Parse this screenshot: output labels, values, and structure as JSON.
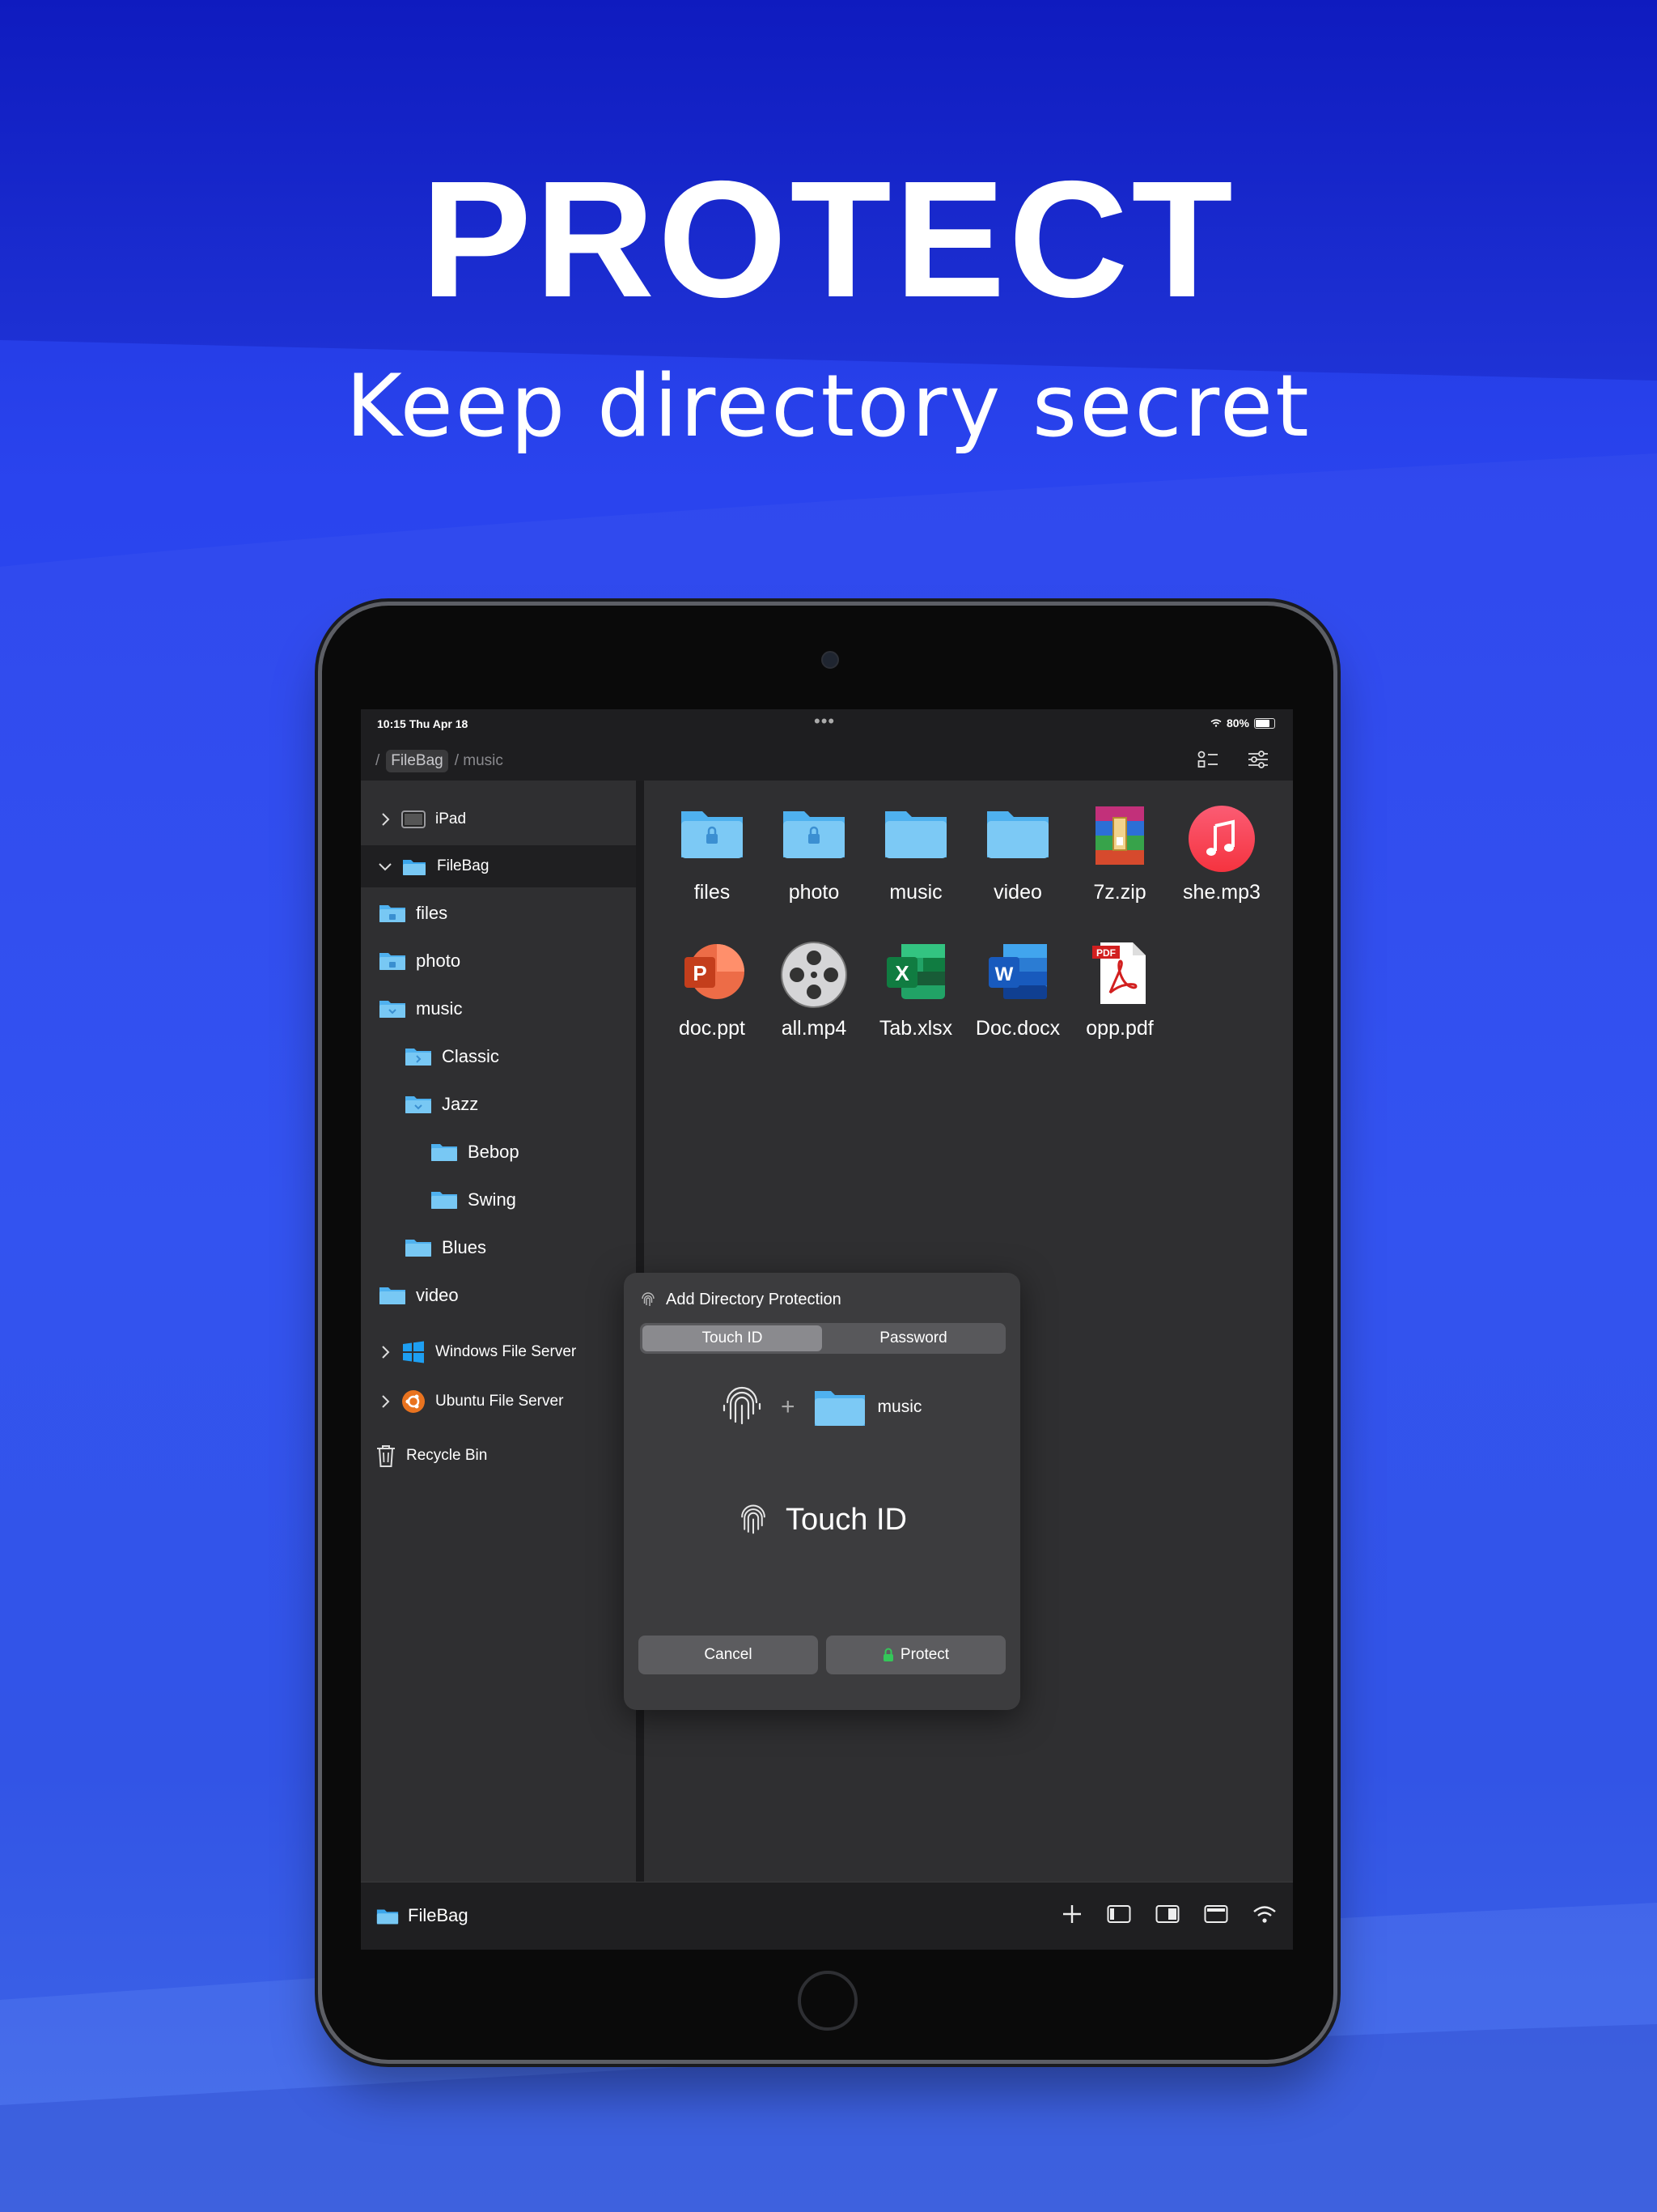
{
  "hero": {
    "title": "PROTECT",
    "subtitle": "Keep directory secret"
  },
  "status": {
    "time": "10:15  Thu Apr 18",
    "battery": "80%",
    "battery_level": 0.8
  },
  "nav": {
    "root_sep": "/",
    "crumb_active": "FileBag",
    "crumb_current": "/ music"
  },
  "sidebar": {
    "items": [
      {
        "label": "iPad",
        "icon": "tablet-icon"
      },
      {
        "label": "FileBag",
        "icon": "folder-icon",
        "selected": true
      },
      {
        "label": "files",
        "icon": "locked-folder-icon"
      },
      {
        "label": "photo",
        "icon": "locked-folder-icon"
      },
      {
        "label": "music",
        "icon": "open-folder-icon"
      },
      {
        "label": "Classic",
        "icon": "folder-icon"
      },
      {
        "label": "Jazz",
        "icon": "open-folder-icon"
      },
      {
        "label": "Bebop",
        "icon": "folder-icon"
      },
      {
        "label": "Swing",
        "icon": "folder-icon"
      },
      {
        "label": "Blues",
        "icon": "folder-icon"
      },
      {
        "label": "video",
        "icon": "folder-icon"
      },
      {
        "label": "Windows File Server",
        "icon": "windows-icon"
      },
      {
        "label": "Ubuntu File Server",
        "icon": "ubuntu-icon"
      },
      {
        "label": "Recycle Bin",
        "icon": "trash-icon"
      }
    ]
  },
  "files": [
    {
      "name": "files",
      "icon": "locked-folder-icon"
    },
    {
      "name": "photo",
      "icon": "locked-folder-icon"
    },
    {
      "name": "music",
      "icon": "folder-icon"
    },
    {
      "name": "video",
      "icon": "folder-icon"
    },
    {
      "name": "7z.zip",
      "icon": "zip-archive-icon"
    },
    {
      "name": "she.mp3",
      "icon": "music-note-icon"
    },
    {
      "name": "doc.ppt",
      "icon": "powerpoint-icon"
    },
    {
      "name": "all.mp4",
      "icon": "film-reel-icon"
    },
    {
      "name": "Tab.xlsx",
      "icon": "excel-icon"
    },
    {
      "name": "Doc.docx",
      "icon": "word-icon"
    },
    {
      "name": "opp.pdf",
      "icon": "pdf-icon"
    }
  ],
  "dialog": {
    "title": "Add Directory Protection",
    "tab_touch": "Touch ID",
    "tab_password": "Password",
    "plus": "+",
    "target_folder": "music",
    "method_label": "Touch ID",
    "cancel": "Cancel",
    "protect": "Protect"
  },
  "pdf_badge": "PDF",
  "toolbar": {
    "label": "FileBag"
  },
  "colors": {
    "folder": "#78c8f4",
    "accent_bg": "#2a44ee",
    "lock_green": "#34c759"
  }
}
